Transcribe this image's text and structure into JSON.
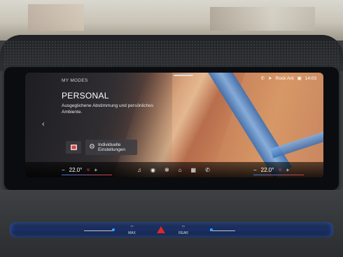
{
  "header": {
    "section_label": "MY MODES",
    "mode_title": "PERSONAL",
    "mode_description": "Ausgeglichene Abstimmung und persönliches Ambiente."
  },
  "status_bar": {
    "phone_icon": "phone-icon",
    "location_icon": "location-arrow-icon",
    "media_source": "Rock Ant",
    "screen_icon": "display-icon",
    "time": "14:03"
  },
  "buttons": {
    "individual_label": "Individuelle Einstellungen"
  },
  "climate": {
    "left_temp": "22.0°",
    "right_temp": "22.0°",
    "minus": "−",
    "plus": "+"
  },
  "quick_bar": {
    "items": [
      "music-icon",
      "navigation-icon",
      "fan-icon",
      "home-icon",
      "apps-icon",
      "phone-icon"
    ]
  },
  "lower_controls": {
    "max_label": "MAX",
    "rear_label": "REAR"
  },
  "colors": {
    "accent_blue": "#3d7bd9",
    "heat_red": "#e04040",
    "hazard_red": "#e02626"
  }
}
